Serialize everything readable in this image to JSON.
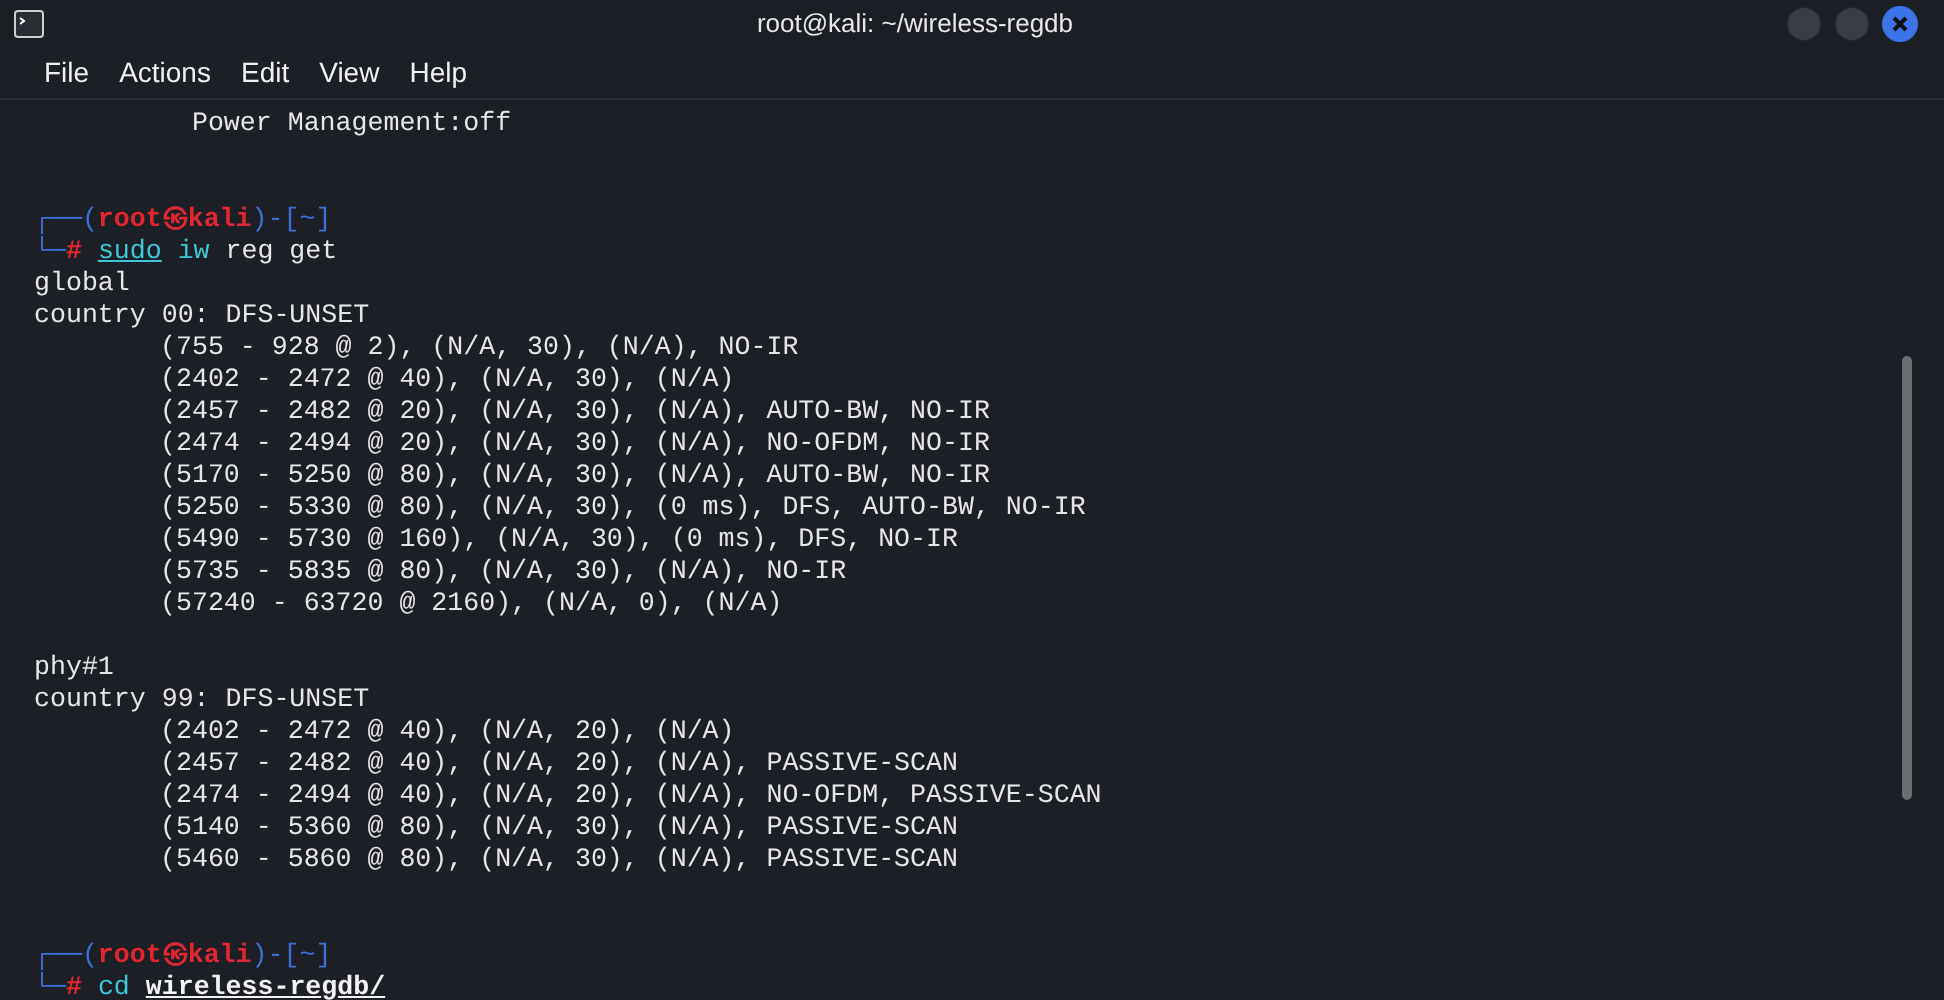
{
  "window": {
    "title": "root@kali: ~/wireless-regdb"
  },
  "menu": [
    "File",
    "Actions",
    "Edit",
    "View",
    "Help"
  ],
  "lines": [
    {
      "kind": "indented",
      "text": "  Power Management:off"
    },
    {
      "kind": "blank"
    },
    {
      "kind": "blank"
    },
    {
      "kind": "rich",
      "tokens": [
        {
          "t": "┌──(",
          "kind": "frame"
        },
        {
          "t": "root㉿kali",
          "kind": "user"
        },
        {
          "t": ")-[",
          "kind": "frame"
        },
        {
          "t": "~",
          "kind": "dir"
        },
        {
          "t": "]",
          "kind": "frame"
        }
      ]
    },
    {
      "kind": "rich",
      "tokens": [
        {
          "t": "└─",
          "kind": "frame"
        },
        {
          "t": "# ",
          "kind": "hash"
        },
        {
          "t": "sudo",
          "kind": "sudo"
        },
        {
          "t": "iw",
          "kind": "cmd",
          "gap": true
        },
        {
          "t": "reg get",
          "kind": "plain",
          "gap": true
        }
      ]
    },
    {
      "kind": "text",
      "text": "global"
    },
    {
      "kind": "text",
      "text": "country 00: DFS-UNSET"
    },
    {
      "kind": "indented",
      "text": "(755 - 928 @ 2), (N/A, 30), (N/A), NO-IR"
    },
    {
      "kind": "indented",
      "text": "(2402 - 2472 @ 40), (N/A, 30), (N/A)"
    },
    {
      "kind": "indented",
      "text": "(2457 - 2482 @ 20), (N/A, 30), (N/A), AUTO-BW, NO-IR"
    },
    {
      "kind": "indented",
      "text": "(2474 - 2494 @ 20), (N/A, 30), (N/A), NO-OFDM, NO-IR"
    },
    {
      "kind": "indented",
      "text": "(5170 - 5250 @ 80), (N/A, 30), (N/A), AUTO-BW, NO-IR"
    },
    {
      "kind": "indented",
      "text": "(5250 - 5330 @ 80), (N/A, 30), (0 ms), DFS, AUTO-BW, NO-IR"
    },
    {
      "kind": "indented",
      "text": "(5490 - 5730 @ 160), (N/A, 30), (0 ms), DFS, NO-IR"
    },
    {
      "kind": "indented",
      "text": "(5735 - 5835 @ 80), (N/A, 30), (N/A), NO-IR"
    },
    {
      "kind": "indented",
      "text": "(57240 - 63720 @ 2160), (N/A, 0), (N/A)"
    },
    {
      "kind": "blank"
    },
    {
      "kind": "text",
      "text": "phy#1"
    },
    {
      "kind": "text",
      "text": "country 99: DFS-UNSET"
    },
    {
      "kind": "indented",
      "text": "(2402 - 2472 @ 40), (N/A, 20), (N/A)"
    },
    {
      "kind": "indented",
      "text": "(2457 - 2482 @ 40), (N/A, 20), (N/A), PASSIVE-SCAN"
    },
    {
      "kind": "indented",
      "text": "(2474 - 2494 @ 40), (N/A, 20), (N/A), NO-OFDM, PASSIVE-SCAN"
    },
    {
      "kind": "indented",
      "text": "(5140 - 5360 @ 80), (N/A, 30), (N/A), PASSIVE-SCAN"
    },
    {
      "kind": "indented",
      "text": "(5460 - 5860 @ 80), (N/A, 30), (N/A), PASSIVE-SCAN"
    },
    {
      "kind": "blank"
    },
    {
      "kind": "blank"
    },
    {
      "kind": "rich",
      "tokens": [
        {
          "t": "┌──(",
          "kind": "frame"
        },
        {
          "t": "root㉿kali",
          "kind": "user"
        },
        {
          "t": ")-[",
          "kind": "frame"
        },
        {
          "t": "~",
          "kind": "dir"
        },
        {
          "t": "]",
          "kind": "frame"
        }
      ]
    },
    {
      "kind": "rich",
      "tokens": [
        {
          "t": "└─",
          "kind": "frame"
        },
        {
          "t": "# ",
          "kind": "hash"
        },
        {
          "t": "cd",
          "kind": "cmd"
        },
        {
          "t": "wireless-regdb/",
          "kind": "path",
          "gap": true
        }
      ]
    }
  ]
}
